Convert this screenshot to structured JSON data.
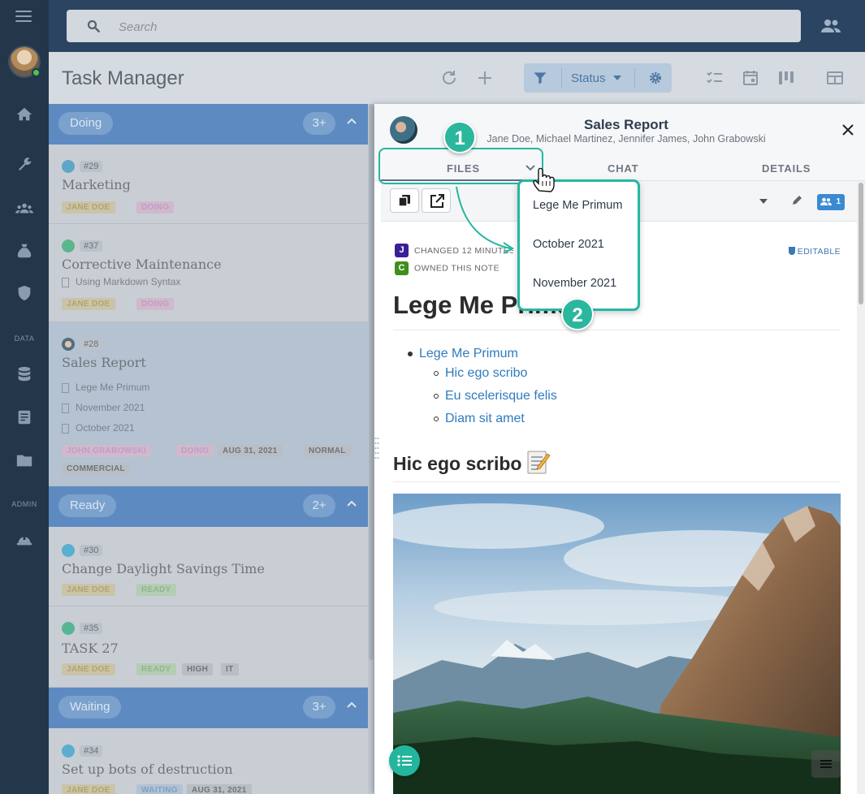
{
  "sidebar": {
    "section_data": "DATA",
    "section_admin": "ADMIN"
  },
  "search": {
    "placeholder": "Search"
  },
  "header": {
    "title": "Task Manager",
    "status_filter": "Status"
  },
  "groups": [
    {
      "label": "Doing",
      "count": "3+"
    },
    {
      "label": "Ready",
      "count": "2+"
    },
    {
      "label": "Waiting",
      "count": "3+"
    }
  ],
  "cards": [
    {
      "num": "#29",
      "title": "Marketing",
      "tags": [
        "JANE DOE",
        "DOING"
      ]
    },
    {
      "num": "#37",
      "title": "Corrective Maintenance",
      "subs": [
        "Using Markdown Syntax"
      ],
      "tags": [
        "JANE DOE",
        "DOING"
      ]
    },
    {
      "num": "#28",
      "title": "Sales Report",
      "subs": [
        "Lege Me Primum",
        "November 2021",
        "October 2021"
      ],
      "tags": [
        "JOHN GRABOWSKI",
        "DOING",
        "AUG 31, 2021",
        "NORMAL",
        "COMMERCIAL"
      ]
    },
    {
      "num": "#30",
      "title": "Change Daylight Savings Time",
      "tags": [
        "JANE DOE",
        "READY"
      ]
    },
    {
      "num": "#35",
      "title": "TASK 27",
      "tags": [
        "JANE DOE",
        "READY",
        "HIGH",
        "IT"
      ]
    },
    {
      "num": "#34",
      "title": "Set up bots of destruction",
      "tags": [
        "JANE DOE",
        "WAITING",
        "AUG 31, 2021"
      ]
    }
  ],
  "panel": {
    "title": "Sales Report",
    "members": "Jane Doe, Michael Martinez, Jennifer James, John Grabowski",
    "tabs": [
      "FILES",
      "CHAT",
      "DETAILS"
    ],
    "member_count": "1",
    "meta_changed_initial": "J",
    "meta_changed": "CHANGED 12 MINUTES AGO",
    "meta_owned_initial": "C",
    "meta_owned": "OWNED THIS NOTE",
    "editable": "EDITABLE",
    "heading1": "Lege Me Primum",
    "list": {
      "top": "Lege Me Primum",
      "items": [
        "Hic ego scribo",
        "Eu scelerisque felis",
        "Diam sit amet"
      ]
    },
    "heading2": "Hic ego scribo"
  },
  "dropdown": {
    "items": [
      "Lege Me Primum",
      "October 2021",
      "November 2021"
    ]
  },
  "annotations": {
    "step1": "1",
    "step2": "2"
  },
  "colors": {
    "accent": "#25b7a0",
    "link": "#2f7bbf",
    "sidebar": "#23364a",
    "group_header": "#5d8bc1"
  }
}
